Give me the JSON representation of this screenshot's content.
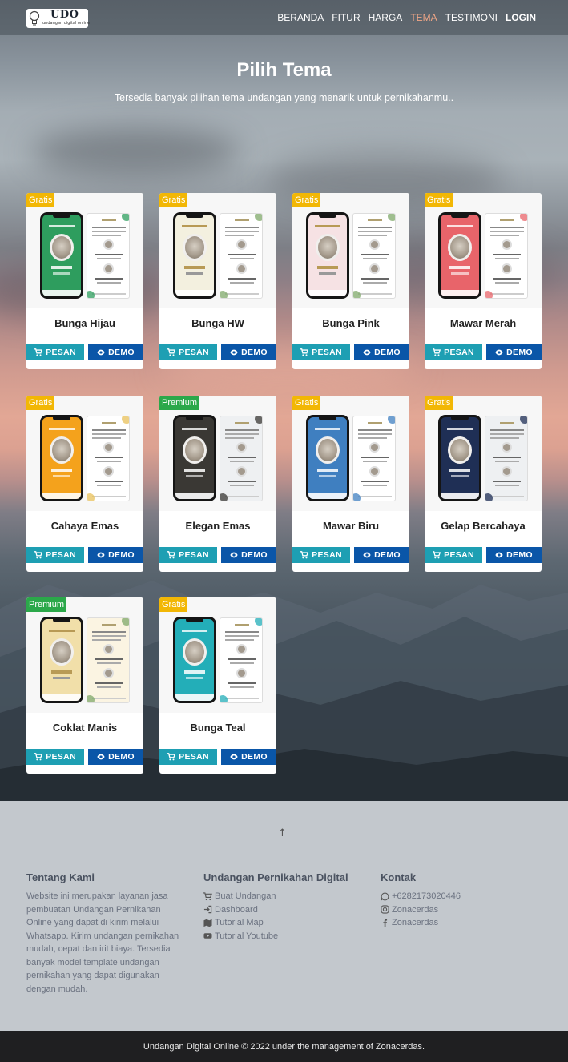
{
  "nav": {
    "brand": "UDO",
    "tagline": "undangan digital online",
    "items": [
      {
        "label": "BERANDA"
      },
      {
        "label": "FITUR"
      },
      {
        "label": "HARGA"
      },
      {
        "label": "TEMA"
      },
      {
        "label": "TESTIMONI"
      },
      {
        "label": "LOGIN"
      }
    ]
  },
  "hero": {
    "title": "Pilih Tema",
    "subtitle": "Tersedia banyak pilihan tema undangan yang menarik untuk pernikahanmu.."
  },
  "buttons": {
    "order": "PESAN",
    "demo": "DEMO"
  },
  "themes": [
    {
      "name": "Bunga Hijau",
      "badge": "Gratis",
      "color": "#2e9d5e"
    },
    {
      "name": "Bunga HW",
      "badge": "Gratis",
      "color": "#f3f0df"
    },
    {
      "name": "Bunga Pink",
      "badge": "Gratis",
      "color": "#f6e2e4"
    },
    {
      "name": "Mawar Merah",
      "badge": "Gratis",
      "color": "#e8646a"
    },
    {
      "name": "Cahaya Emas",
      "badge": "Gratis",
      "color": "#f4a21c"
    },
    {
      "name": "Elegan Emas",
      "badge": "Premium",
      "color": "#3a3834"
    },
    {
      "name": "Mawar Biru",
      "badge": "Gratis",
      "color": "#3f7fc0"
    },
    {
      "name": "Gelap Bercahaya",
      "badge": "Gratis",
      "color": "#1f2f55"
    },
    {
      "name": "Coklat Manis",
      "badge": "Premium",
      "color": "#f1dfa9"
    },
    {
      "name": "Bunga Teal",
      "badge": "Gratis",
      "color": "#23aeb8"
    }
  ],
  "footer": {
    "about": {
      "title": "Tentang Kami",
      "text": "Website ini merupakan layanan jasa pembuatan Undangan Pernikahan Online yang dapat di kirim melalui Whatsapp. Kirim undangan pernikahan mudah, cepat dan irit biaya. Tersedia banyak model template undangan pernikahan yang dapat digunakan dengan mudah."
    },
    "links": {
      "title": "Undangan Pernikahan Digital",
      "items": [
        "Buat Undangan",
        "Dashboard",
        "Tutorial Map",
        "Tutorial Youtube"
      ]
    },
    "contact": {
      "title": "Kontak",
      "items": [
        "+6282173020446",
        "Zonacerdas",
        "Zonacerdas"
      ]
    },
    "copyright": "Undangan Digital Online © 2022 under the management of Zonacerdas."
  },
  "colors": {
    "gratis": "#f2b705",
    "premium": "#2ba84a",
    "pesan": "#1e9fb3",
    "demo": "#0a56a8",
    "nav_active": "#f0a686"
  }
}
